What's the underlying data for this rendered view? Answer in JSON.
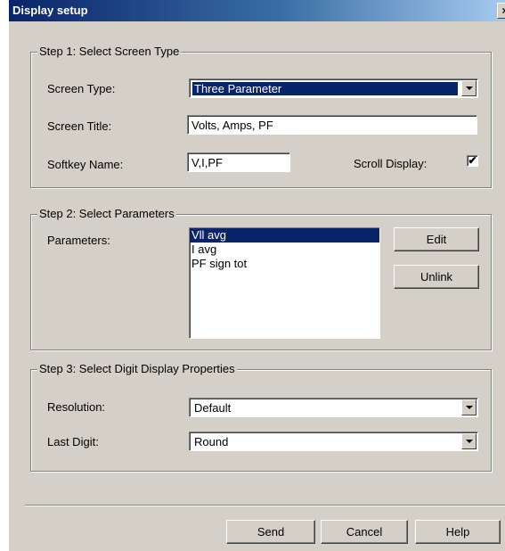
{
  "window": {
    "title": "Display setup",
    "close_glyph": "×"
  },
  "step1": {
    "legend": "Step 1: Select Screen Type",
    "screen_type_label": "Screen Type:",
    "screen_type_value": "Three Parameter",
    "screen_title_label": "Screen Title:",
    "screen_title_value": "Volts, Amps, PF",
    "softkey_label": "Softkey Name:",
    "softkey_value": "V,I,PF",
    "scroll_label": "Scroll Display:",
    "scroll_checked": true,
    "check_glyph": "✔"
  },
  "step2": {
    "legend": "Step 2: Select Parameters",
    "parameters_label": "Parameters:",
    "parameters": [
      "Vll avg",
      "I avg",
      "PF sign tot"
    ],
    "selected_index": 0,
    "edit_label": "Edit",
    "unlink_label": "Unlink"
  },
  "step3": {
    "legend": "Step 3: Select Digit Display Properties",
    "resolution_label": "Resolution:",
    "resolution_value": "Default",
    "last_digit_label": "Last Digit:",
    "last_digit_value": "Round"
  },
  "footer": {
    "send_label": "Send",
    "cancel_label": "Cancel",
    "help_label": "Help"
  },
  "colors": {
    "dialog_bg": "#d4d0c8",
    "title_bar": "#0a246a",
    "selection": "#0a246a"
  }
}
